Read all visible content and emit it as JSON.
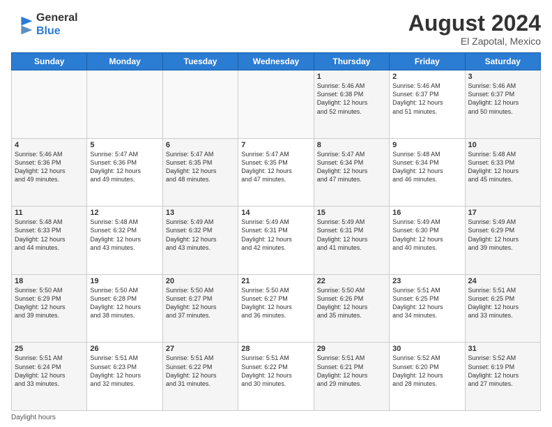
{
  "header": {
    "logo_general": "General",
    "logo_blue": "Blue",
    "month_title": "August 2024",
    "location": "El Zapotal, Mexico"
  },
  "footer": {
    "note": "Daylight hours"
  },
  "days_of_week": [
    "Sunday",
    "Monday",
    "Tuesday",
    "Wednesday",
    "Thursday",
    "Friday",
    "Saturday"
  ],
  "weeks": [
    {
      "days": [
        {
          "num": "",
          "info": ""
        },
        {
          "num": "",
          "info": ""
        },
        {
          "num": "",
          "info": ""
        },
        {
          "num": "",
          "info": ""
        },
        {
          "num": "1",
          "info": "Sunrise: 5:46 AM\nSunset: 6:38 PM\nDaylight: 12 hours\nand 52 minutes."
        },
        {
          "num": "2",
          "info": "Sunrise: 5:46 AM\nSunset: 6:37 PM\nDaylight: 12 hours\nand 51 minutes."
        },
        {
          "num": "3",
          "info": "Sunrise: 5:46 AM\nSunset: 6:37 PM\nDaylight: 12 hours\nand 50 minutes."
        }
      ]
    },
    {
      "days": [
        {
          "num": "4",
          "info": "Sunrise: 5:46 AM\nSunset: 6:36 PM\nDaylight: 12 hours\nand 49 minutes."
        },
        {
          "num": "5",
          "info": "Sunrise: 5:47 AM\nSunset: 6:36 PM\nDaylight: 12 hours\nand 49 minutes."
        },
        {
          "num": "6",
          "info": "Sunrise: 5:47 AM\nSunset: 6:35 PM\nDaylight: 12 hours\nand 48 minutes."
        },
        {
          "num": "7",
          "info": "Sunrise: 5:47 AM\nSunset: 6:35 PM\nDaylight: 12 hours\nand 47 minutes."
        },
        {
          "num": "8",
          "info": "Sunrise: 5:47 AM\nSunset: 6:34 PM\nDaylight: 12 hours\nand 47 minutes."
        },
        {
          "num": "9",
          "info": "Sunrise: 5:48 AM\nSunset: 6:34 PM\nDaylight: 12 hours\nand 46 minutes."
        },
        {
          "num": "10",
          "info": "Sunrise: 5:48 AM\nSunset: 6:33 PM\nDaylight: 12 hours\nand 45 minutes."
        }
      ]
    },
    {
      "days": [
        {
          "num": "11",
          "info": "Sunrise: 5:48 AM\nSunset: 6:33 PM\nDaylight: 12 hours\nand 44 minutes."
        },
        {
          "num": "12",
          "info": "Sunrise: 5:48 AM\nSunset: 6:32 PM\nDaylight: 12 hours\nand 43 minutes."
        },
        {
          "num": "13",
          "info": "Sunrise: 5:49 AM\nSunset: 6:32 PM\nDaylight: 12 hours\nand 43 minutes."
        },
        {
          "num": "14",
          "info": "Sunrise: 5:49 AM\nSunset: 6:31 PM\nDaylight: 12 hours\nand 42 minutes."
        },
        {
          "num": "15",
          "info": "Sunrise: 5:49 AM\nSunset: 6:31 PM\nDaylight: 12 hours\nand 41 minutes."
        },
        {
          "num": "16",
          "info": "Sunrise: 5:49 AM\nSunset: 6:30 PM\nDaylight: 12 hours\nand 40 minutes."
        },
        {
          "num": "17",
          "info": "Sunrise: 5:49 AM\nSunset: 6:29 PM\nDaylight: 12 hours\nand 39 minutes."
        }
      ]
    },
    {
      "days": [
        {
          "num": "18",
          "info": "Sunrise: 5:50 AM\nSunset: 6:29 PM\nDaylight: 12 hours\nand 39 minutes."
        },
        {
          "num": "19",
          "info": "Sunrise: 5:50 AM\nSunset: 6:28 PM\nDaylight: 12 hours\nand 38 minutes."
        },
        {
          "num": "20",
          "info": "Sunrise: 5:50 AM\nSunset: 6:27 PM\nDaylight: 12 hours\nand 37 minutes."
        },
        {
          "num": "21",
          "info": "Sunrise: 5:50 AM\nSunset: 6:27 PM\nDaylight: 12 hours\nand 36 minutes."
        },
        {
          "num": "22",
          "info": "Sunrise: 5:50 AM\nSunset: 6:26 PM\nDaylight: 12 hours\nand 35 minutes."
        },
        {
          "num": "23",
          "info": "Sunrise: 5:51 AM\nSunset: 6:25 PM\nDaylight: 12 hours\nand 34 minutes."
        },
        {
          "num": "24",
          "info": "Sunrise: 5:51 AM\nSunset: 6:25 PM\nDaylight: 12 hours\nand 33 minutes."
        }
      ]
    },
    {
      "days": [
        {
          "num": "25",
          "info": "Sunrise: 5:51 AM\nSunset: 6:24 PM\nDaylight: 12 hours\nand 33 minutes."
        },
        {
          "num": "26",
          "info": "Sunrise: 5:51 AM\nSunset: 6:23 PM\nDaylight: 12 hours\nand 32 minutes."
        },
        {
          "num": "27",
          "info": "Sunrise: 5:51 AM\nSunset: 6:22 PM\nDaylight: 12 hours\nand 31 minutes."
        },
        {
          "num": "28",
          "info": "Sunrise: 5:51 AM\nSunset: 6:22 PM\nDaylight: 12 hours\nand 30 minutes."
        },
        {
          "num": "29",
          "info": "Sunrise: 5:51 AM\nSunset: 6:21 PM\nDaylight: 12 hours\nand 29 minutes."
        },
        {
          "num": "30",
          "info": "Sunrise: 5:52 AM\nSunset: 6:20 PM\nDaylight: 12 hours\nand 28 minutes."
        },
        {
          "num": "31",
          "info": "Sunrise: 5:52 AM\nSunset: 6:19 PM\nDaylight: 12 hours\nand 27 minutes."
        }
      ]
    }
  ]
}
